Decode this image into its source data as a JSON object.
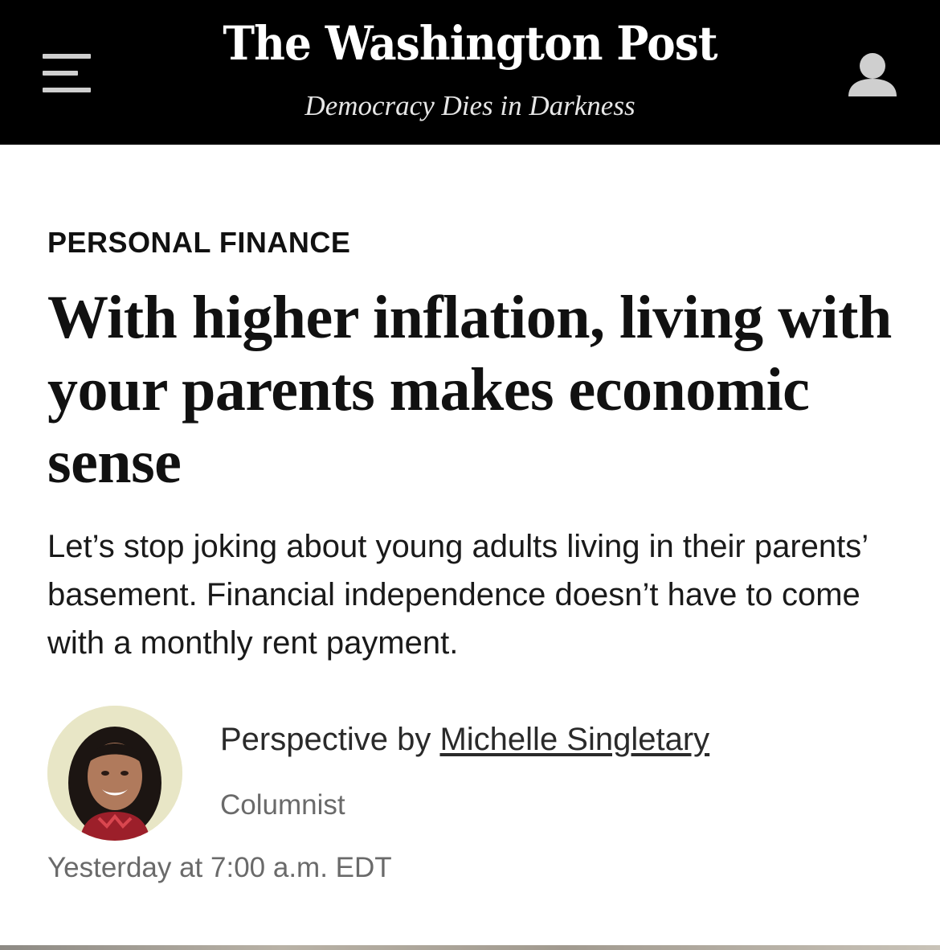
{
  "header": {
    "logo_text": "The Washington Post",
    "tagline": "Democracy Dies in Darkness",
    "background_color": "#000000"
  },
  "article": {
    "section": "PERSONAL FINANCE",
    "headline": "With higher inflation, living with your parents makes economic sense",
    "dek": "Let’s stop joking about young adults living in their parents’ basement. Financial independence doesn’t have to come with a monthly rent payment.",
    "byline_prefix": "Perspective by",
    "author": "Michelle Singletary",
    "author_role": "Columnist",
    "timestamp": "Yesterday at 7:00 a.m. EDT"
  }
}
